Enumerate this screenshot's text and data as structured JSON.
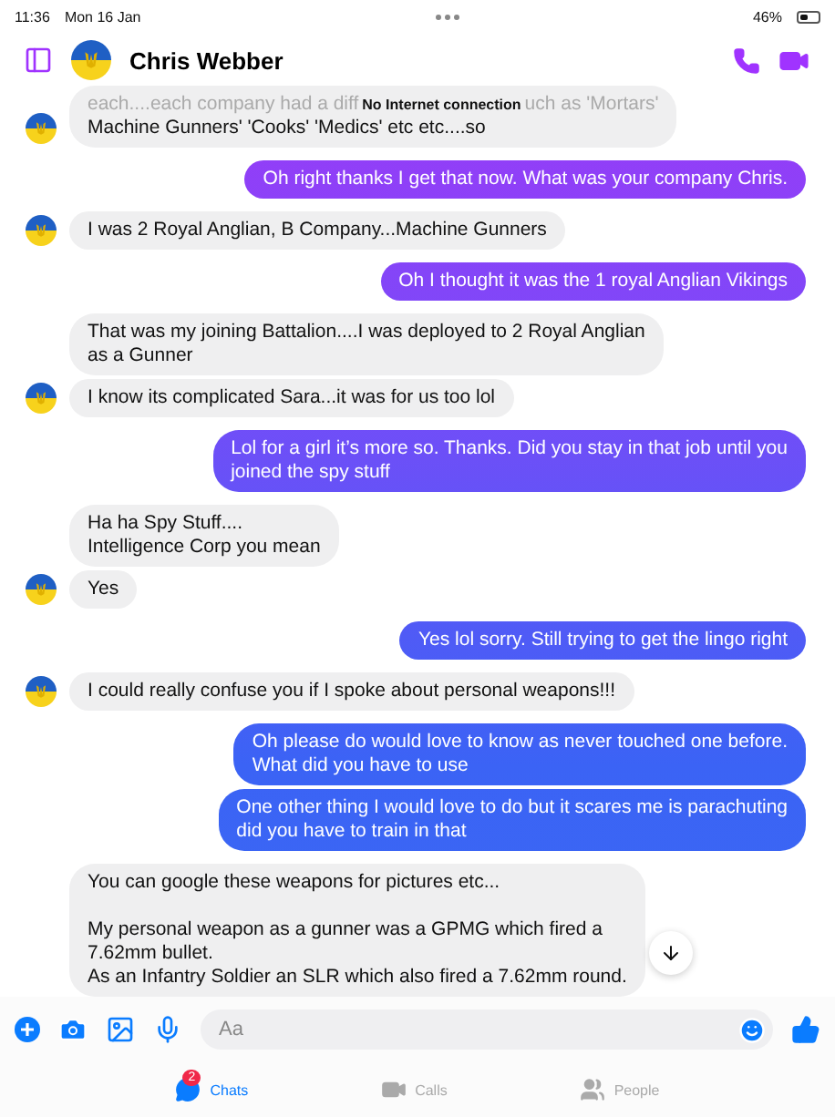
{
  "status_bar": {
    "time": "11:36",
    "date": "Mon 16 Jan",
    "battery": "46%"
  },
  "header": {
    "contact_name": "Chris Webber",
    "notice": "No Internet connection"
  },
  "messages": [
    {
      "kind": "incoming",
      "partial_start": "each....each company had a diff",
      "partial_end": "uch as 'Mortars'",
      "text": "Machine Gunners' 'Cooks' 'Medics' etc etc....so"
    },
    {
      "kind": "outgoing",
      "text": "Oh right thanks I get that now. What was your company Chris."
    },
    {
      "kind": "incoming",
      "text": "I was 2 Royal Anglian, B Company...Machine Gunners"
    },
    {
      "kind": "outgoing",
      "text": "Oh I thought it was the 1 royal Anglian Vikings"
    },
    {
      "kind": "incoming",
      "text": "That was my joining Battalion....I was deployed to 2 Royal Anglian\nas a Gunner"
    },
    {
      "kind": "incoming",
      "text": "I know its complicated Sara...it was for us too lol"
    },
    {
      "kind": "outgoing",
      "text": "Lol for a girl it’s more so. Thanks. Did you stay in that job until you\njoined the spy stuff"
    },
    {
      "kind": "incoming",
      "text": "Ha ha Spy Stuff....\nIntelligence Corp you mean"
    },
    {
      "kind": "incoming",
      "text": "Yes"
    },
    {
      "kind": "outgoing",
      "text": "Yes lol sorry. Still trying to get the lingo right"
    },
    {
      "kind": "incoming",
      "text": "I could really confuse you if I spoke about personal weapons!!!"
    },
    {
      "kind": "outgoing",
      "text": "Oh please do would love to know as never touched one before.\nWhat did you have to use"
    },
    {
      "kind": "outgoing",
      "text": "One other thing I would love to do but it scares me is parachuting\ndid you have to train in that"
    },
    {
      "kind": "incoming",
      "text": "You can google these weapons for pictures etc...\n\nMy personal weapon as a gunner was a GPMG which fired a\n7.62mm bullet.\nAs an Infantry Soldier an SLR which also fired a 7.62mm round."
    }
  ],
  "composer": {
    "placeholder": "Aa"
  },
  "tabs": [
    {
      "kind": "chats",
      "label": "Chats",
      "selected": true,
      "badge": "2"
    },
    {
      "kind": "calls",
      "label": "Calls",
      "selected": false
    },
    {
      "kind": "people",
      "label": "People",
      "selected": false
    }
  ]
}
